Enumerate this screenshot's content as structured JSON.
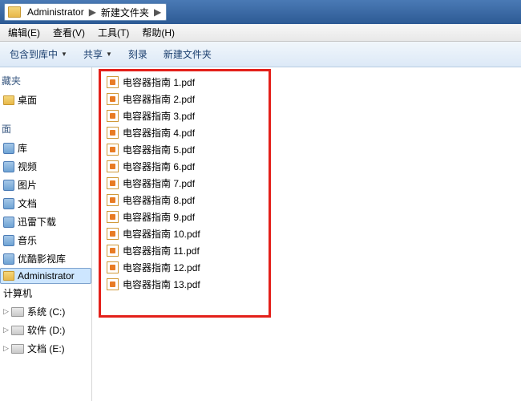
{
  "address": {
    "crumbs": [
      "Administrator",
      "新建文件夹"
    ],
    "sep": "▶"
  },
  "menu": [
    "编辑(E)",
    "查看(V)",
    "工具(T)",
    "帮助(H)"
  ],
  "toolbar": [
    "包含到库中",
    "共享",
    "刻录",
    "新建文件夹"
  ],
  "sidebar": {
    "fav_header": "藏夹",
    "fav": [
      "桌面"
    ],
    "lib_header": "面",
    "libs": [
      "库",
      "视频",
      "图片",
      "文档",
      "迅雷下载",
      "音乐",
      "优酷影视库"
    ],
    "user": "Administrator",
    "computer": "计算机",
    "drives": [
      "系统 (C:)",
      "软件 (D:)",
      "文档 (E:)"
    ]
  },
  "files": [
    "电容器指南 1.pdf",
    "电容器指南 2.pdf",
    "电容器指南 3.pdf",
    "电容器指南 4.pdf",
    "电容器指南 5.pdf",
    "电容器指南 6.pdf",
    "电容器指南 7.pdf",
    "电容器指南 8.pdf",
    "电容器指南 9.pdf",
    "电容器指南 10.pdf",
    "电容器指南 11.pdf",
    "电容器指南 12.pdf",
    "电容器指南 13.pdf"
  ]
}
